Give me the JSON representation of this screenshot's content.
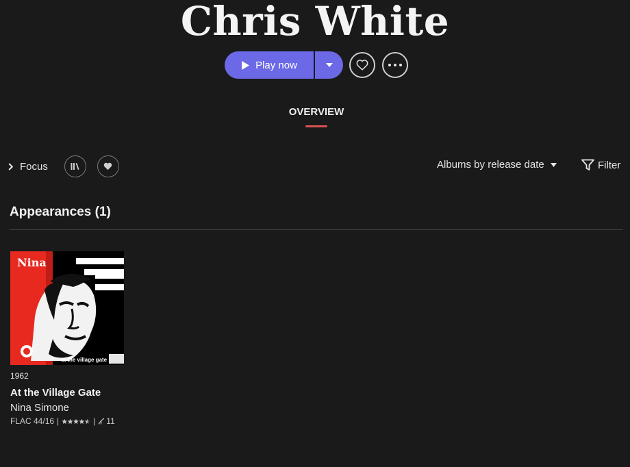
{
  "artist": {
    "name": "Chris White"
  },
  "actions": {
    "play_label": "Play now",
    "play_icon": "play-icon",
    "dropdown_icon": "caret-down-icon",
    "favorite_icon": "heart-outline-icon",
    "more_icon": "more-dots-icon",
    "accent_color": "#6c69e6"
  },
  "tabs": [
    {
      "label": "OVERVIEW",
      "active": true,
      "underline_color": "#d9534f"
    }
  ],
  "toolbar": {
    "focus_label": "Focus",
    "sort_label": "Albums by release date",
    "filter_label": "Filter"
  },
  "section": {
    "title": "Appearances (1)"
  },
  "albums": [
    {
      "year": "1962",
      "title": "At the Village Gate",
      "artist": "Nina Simone",
      "format": "FLAC 44/16",
      "separator": "|",
      "rating": 4.5,
      "track_count": "11",
      "cover_text": "Nina",
      "cover_subtitle": "at the village gate"
    }
  ]
}
